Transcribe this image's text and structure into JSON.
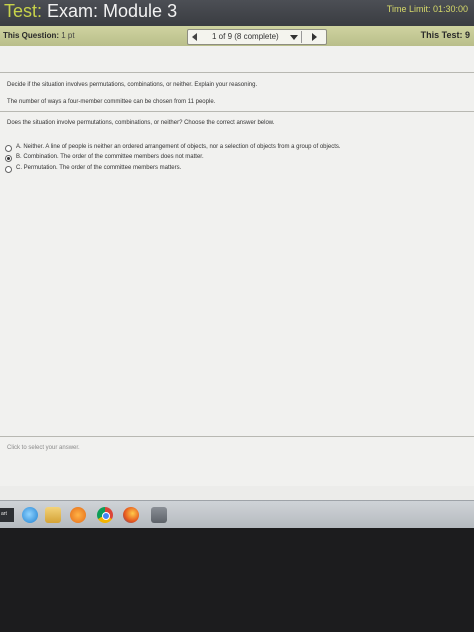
{
  "header": {
    "title_prefix": "Test:",
    "title_name": " Exam: Module 3",
    "time_limit": "Time Limit: 01:30:00"
  },
  "question_bar": {
    "this_question_label": "This Question:",
    "points": " 1 pt",
    "nav_label": "1 of 9 (8 complete)",
    "this_test_label": "This Test: 9"
  },
  "question": {
    "instruction": "Decide if the situation involves permutations, combinations, or neither. Explain your reasoning.",
    "situation": "The number of ways a four-member committee can be chosen from 11 people.",
    "prompt": "Does the situation involve permutations, combinations, or neither? Choose the correct answer below.",
    "options": [
      {
        "label": "A.  Neither. A line of people is neither an ordered arrangement of objects, nor a selection of objects from a group of objects.",
        "selected": false
      },
      {
        "label": "B.  Combination. The order of the committee members does not matter.",
        "selected": true
      },
      {
        "label": "C.  Permutation. The order of the committee members matters.",
        "selected": false
      }
    ]
  },
  "status_text": "Click to select your answer.",
  "taskbar": {
    "start_label": "art",
    "icons": [
      "internet-explorer-icon",
      "folder-icon",
      "media-player-icon",
      "chrome-icon",
      "firefox-icon",
      "app-icon"
    ]
  },
  "colors": {
    "title_accent": "#c7d24a",
    "question_bar": "#c6ca96",
    "content_bg": "#f1f1ef"
  }
}
